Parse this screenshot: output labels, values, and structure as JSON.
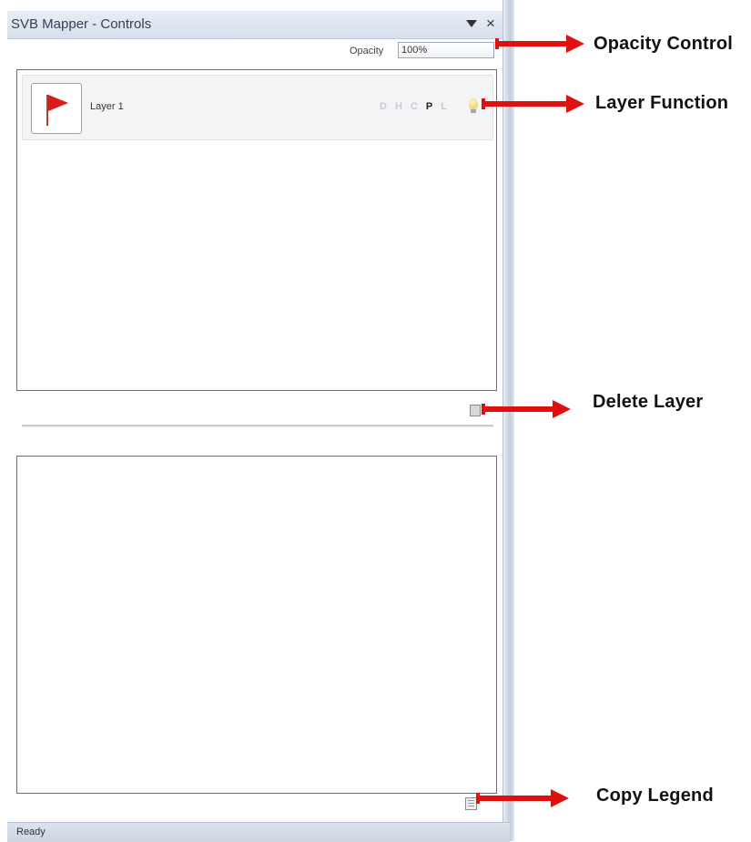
{
  "window": {
    "title": "SVB Mapper - Controls",
    "dropdown_icon": "triangle-down-icon",
    "close_icon": "close-icon",
    "close_glyph": "×"
  },
  "opacity": {
    "label": "Opacity",
    "value": "100%"
  },
  "layers": [
    {
      "name": "Layer 1",
      "thumbnail_icon": "red-flag-icon",
      "functions": [
        {
          "letter": "D",
          "active": false
        },
        {
          "letter": "H",
          "active": false
        },
        {
          "letter": "C",
          "active": false
        },
        {
          "letter": "P",
          "active": true
        },
        {
          "letter": "L",
          "active": false
        }
      ],
      "light_icon": "lightbulb-icon"
    }
  ],
  "status": {
    "text": "Ready"
  },
  "annotations": {
    "opacity_control": "Opacity Control",
    "layer_function": "Layer Function",
    "delete_layer": "Delete Layer",
    "copy_legend": "Copy Legend"
  },
  "colors": {
    "arrow": "#e01010",
    "flag": "#d81b1b",
    "titlebar": "#d6dfeb"
  }
}
